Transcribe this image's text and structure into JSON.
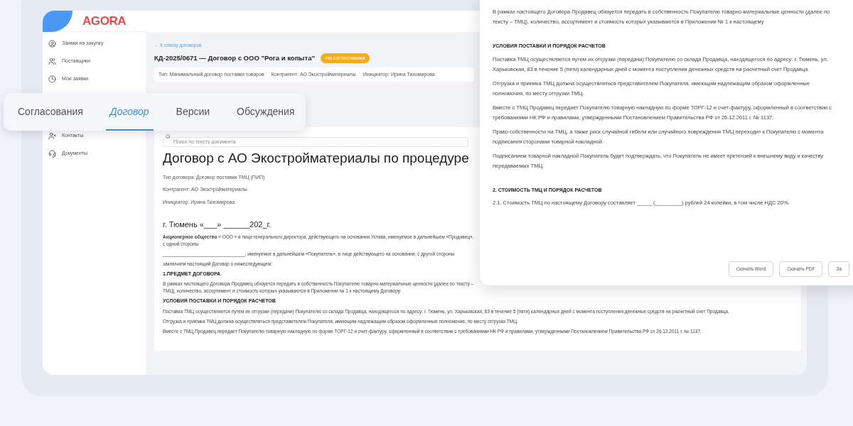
{
  "logo": {
    "text": "AGORA"
  },
  "sidebar": {
    "items": [
      {
        "label": "Заявки на закупку"
      },
      {
        "label": "Поставщики"
      },
      {
        "label": "Мои заявки"
      },
      {
        "label": "Контакты"
      },
      {
        "label": "Документы"
      }
    ]
  },
  "breadcrumb": "← К списку договоров",
  "title": "КД-2025/0671 — Договор с ООО \"Рога и копыта\"",
  "status_badge": "На согласовании",
  "info": [
    {
      "label": "Тип:",
      "value": "Минимальный договор поставки товаров"
    },
    {
      "label": "Контрагент:",
      "value": "АО Экостройматериалы"
    },
    {
      "label": "Инициатор:",
      "value": "Ирина Тихомирова"
    }
  ],
  "tabs": [
    {
      "label": "Согласования",
      "selected": false
    },
    {
      "label": "Договор",
      "selected": true
    },
    {
      "label": "Версии",
      "selected": false
    },
    {
      "label": "Обсуждения",
      "selected": false
    }
  ],
  "document": {
    "search": {
      "placeholder": "Поиск по тексту документа"
    },
    "heading": "Договор с АО Экостройматериалы по процедуре",
    "meta": [
      "Тип договора: Договор поставки ТМЦ (ПИП)",
      "Контрагент: АО Экостройматериалы",
      "Инициатор: Ирина Тихомирова"
    ],
    "city_line": "г. Тюмень «___» ______202_г.",
    "blocks": [
      {
        "kind": "para",
        "text": "**Акционерное общество** « ООО » в лице генерального директора, действующего на основании Устава, именуемое в дальнейшем «Продавец», с одной стороны"
      },
      {
        "kind": "para",
        "text": "________________________________, именуемое в дальнейшем «Покупатель», в лице действующего на основании, с другой стороны"
      },
      {
        "kind": "para",
        "text": "заключили настоящий Договор о нижеследующем:"
      },
      {
        "kind": "heading",
        "text": "1.ПРЕДМЕТ ДОГОВОРА"
      },
      {
        "kind": "para",
        "text": "В рамках настоящего Договора Продавец обязуется передать в собственность Покупателю товарно-материальные ценности (далее по тексту – ТМЦ), количество, ассортимент и стоимость которых указываются в Приложении № 1 к настоящему Договору."
      },
      {
        "kind": "heading",
        "text": "УСЛОВИЯ ПОСТАВКИ И ПОРЯДОК РАСЧЕТОВ"
      },
      {
        "kind": "para",
        "text": "Поставка ТМЦ осуществляется путем их отгрузки (передачи) Покупателю со склада Продавца, находящегося по адресу: г. Тюмень, ул. Харьковская, 83 в течение 5 (пяти) календарных дней с момента поступления денежных средств на расчетный счет Продавца."
      },
      {
        "kind": "para",
        "text": "Отгрузка и приемка ТМЦ должна осуществляться представителем Покупателя, имеющим надлежащим образом оформленные полномочия, по месту отгрузки ТМЦ."
      },
      {
        "kind": "para",
        "text": "Вместе с ТМЦ Продавец передает Покупателю товарную накладную по форме ТОРГ-12 и счет-фактуру, оформленный в соответствии с требованиями НК РФ и правилами, утвержденными Постановлением Правительства РФ от 26.12.2011 г. № 1137."
      }
    ]
  },
  "overlay": {
    "paragraphs": [
      {
        "kind": "para",
        "text": "В рамках настоящего Договора Продавец обязуется передать в собственность Покупателю товарно-материальные ценности (далее по тексту – ТМЦ), количество, ассортимент и стоимость которых указываются в Приложении № 1 к настоящему"
      },
      {
        "kind": "heading",
        "text": "УСЛОВИЯ ПОСТАВКИ И ПОРЯДОК РАСЧЕТОВ"
      },
      {
        "kind": "para",
        "text": "Поставка ТМЦ осуществляется путем их отгрузки (передачи) Покупателю со склада Продавца, находящегося по адресу: г. Тюмень, ул. Харьковская, 83 в течение 5 (пяти) календарных дней с момента поступления денежных средств на расчетный счет Продавца."
      },
      {
        "kind": "para",
        "text": "Отгрузка и приемка ТМЦ должна осуществляться представителем Покупателя, имеющим надлежащим образом оформленные полномочия, по месту отгрузки ТМЦ."
      },
      {
        "kind": "para",
        "text": "Вместе с ТМЦ Продавец передает Покупателю товарную накладную по форме ТОРГ-12 и счет-фактуру, оформленный в соответствии с требованиями НК РФ и правилами, утвержденными Постановлением Правительства РФ от 26.12.2011 г. № 1137."
      },
      {
        "kind": "para",
        "text": "Право собственности на ТМЦ, а также риск случайной гибели или случайного повреждения ТМЦ переходит к Покупателю с момента подписания сторонами товарной накладной."
      },
      {
        "kind": "para",
        "text": "Подписанием товарной накладной Покупатель будет подтверждать, что Покупатель не имеет претензий к внешнему виду и качеству передаваемых ТМЦ."
      },
      {
        "kind": "heading",
        "text": "2. СТОИМОСТЬ ТМЦ И ПОРЯДОК РАСЧЕТОВ"
      },
      {
        "kind": "para",
        "text": "2.1. Стоимость ТМЦ по настоящему Договору составляет _____ (_________) рублей 24 копейки, в том числе НДС 20%."
      }
    ],
    "buttons": [
      "Скачать Word",
      "Скачать PDF",
      "За"
    ]
  }
}
